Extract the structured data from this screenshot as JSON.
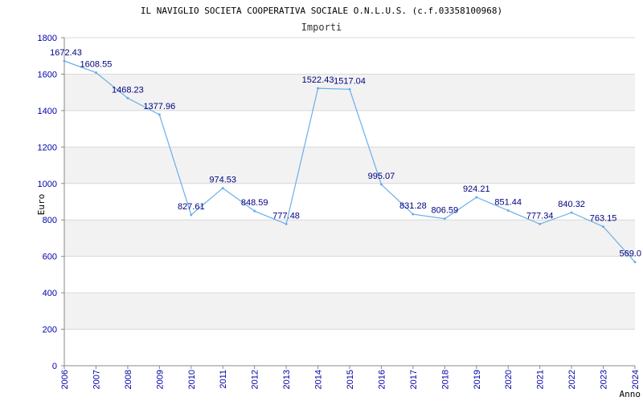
{
  "chart_data": {
    "type": "line",
    "title": "IL NAVIGLIO SOCIETA COOPERATIVA SOCIALE O.N.L.U.S. (c.f.03358100968)",
    "subtitle": "Importi",
    "xlabel": "Anno",
    "ylabel": "Euro",
    "ylim": [
      0,
      1800
    ],
    "yticks": [
      0,
      200,
      400,
      600,
      800,
      1000,
      1200,
      1400,
      1600,
      1800
    ],
    "grid": true,
    "x": [
      "2006",
      "2007",
      "2008",
      "2009",
      "2010",
      "2011",
      "2012",
      "2013",
      "2014",
      "2015",
      "2016",
      "2017",
      "2018",
      "2019",
      "2020",
      "2021",
      "2022",
      "2023",
      "2024"
    ],
    "series": [
      {
        "values": [
          1672.43,
          1608.55,
          1468.23,
          1377.96,
          827.61,
          974.53,
          848.59,
          777.48,
          1522.43,
          1517.04,
          995.07,
          831.28,
          806.59,
          924.21,
          851.44,
          777.34,
          840.32,
          763.15,
          569.0
        ],
        "labels": [
          "1672.43",
          "1608.55",
          "1468.23",
          "1377.96",
          "827.61",
          "974.53",
          "848.59",
          "777.48",
          "1522.43",
          "1517.04",
          "995.07",
          "831.28",
          "806.59",
          "924.21",
          "851.44",
          "777.34",
          "840.32",
          "763.15",
          "569.0"
        ]
      }
    ],
    "colors": {
      "line": "#6aaee8",
      "band": "#f2f2f2",
      "grid": "#d8d8d8",
      "axis": "#888888",
      "tick_text": "#0000aa",
      "data_label": "#000080"
    }
  }
}
